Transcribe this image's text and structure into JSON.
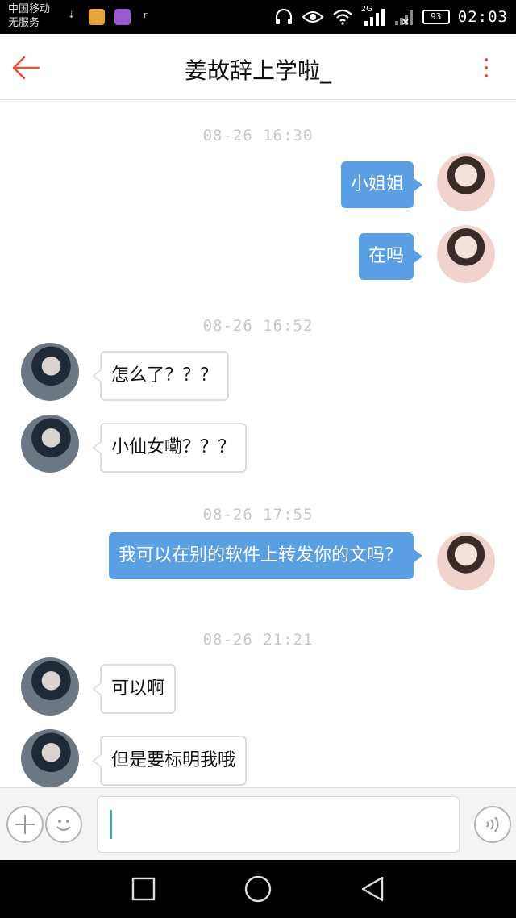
{
  "status_bar": {
    "carrier_line1": "中国移动",
    "carrier_line2": "无服务",
    "network": "2G",
    "battery": "93",
    "time": "02:03"
  },
  "header": {
    "title": "姜故辞上学啦_"
  },
  "messages": [
    {
      "type": "time",
      "text": "08-26 16:30"
    },
    {
      "type": "out",
      "text": "小姐姐"
    },
    {
      "type": "out",
      "text": "在吗"
    },
    {
      "type": "time",
      "text": "08-26 16:52"
    },
    {
      "type": "in",
      "text": "怎么了？？？"
    },
    {
      "type": "in",
      "text": "小仙女嘞？？？"
    },
    {
      "type": "time",
      "text": "08-26 17:55"
    },
    {
      "type": "out",
      "text": "我可以在别的软件上转发你的文吗？"
    },
    {
      "type": "time",
      "text": "08-26 21:21"
    },
    {
      "type": "in",
      "text": "可以啊"
    },
    {
      "type": "in",
      "text": "但是要标明我哦"
    }
  ],
  "colors": {
    "accent": "#e8503c",
    "outgoing_bubble": "#5a9fe4",
    "timestamp": "#c7c7c7"
  },
  "icons": {
    "back": "arrow-left-icon",
    "more": "more-vertical-icon",
    "add": "plus-icon",
    "emoji": "smiley-icon",
    "voice": "voice-wave-icon"
  }
}
